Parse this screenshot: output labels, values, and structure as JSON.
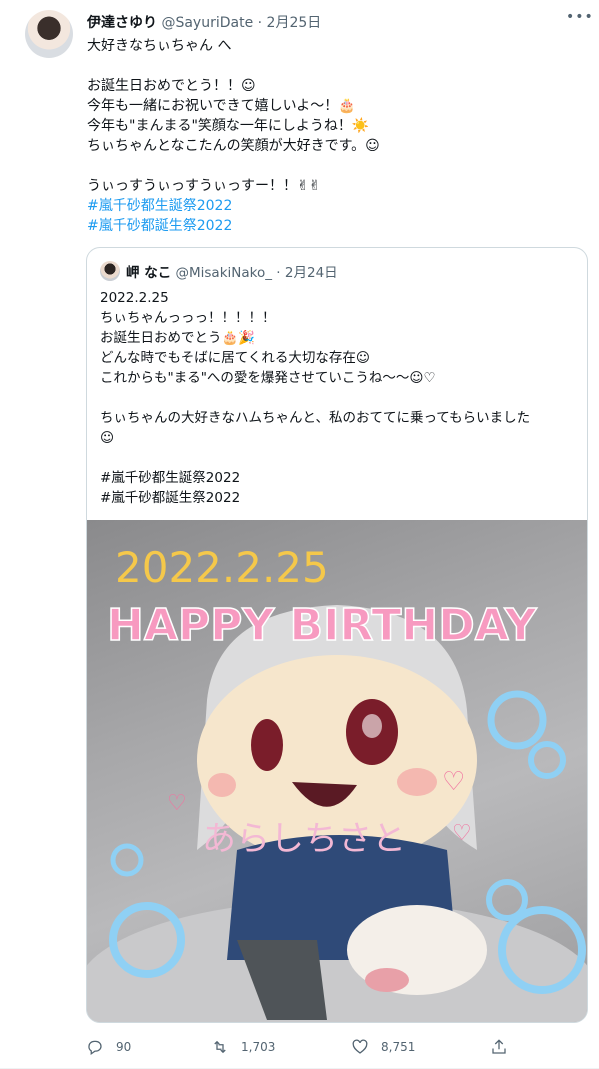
{
  "tweet": {
    "display_name": "伊達さゆり",
    "handle": "@SayuriDate",
    "separator": "·",
    "date": "2月25日",
    "more_label": "•••",
    "lines": [
      "大好きなちぃちゃん へ",
      "",
      "お誕生日おめでとう！！☺",
      "今年も一緒にお祝いできて嬉しいよ〜！🎂",
      "今年も\"まんまる\"笑顔な一年にしようね！☀️",
      "ちぃちゃんとなこたんの笑顔が大好きです。☺",
      "",
      "うぃっすうぃっすうぃっすー！！✌✌"
    ],
    "hashtags": [
      "#嵐千砂都生誕祭2022",
      "#嵐千砂都誕生祭2022"
    ]
  },
  "quote": {
    "display_name": "岬 なこ",
    "handle": "@MisakiNako_",
    "separator": "·",
    "date": "2月24日",
    "lines": [
      "2022.2.25",
      "ちぃちゃんっっっ！！！！！",
      "お誕生日おめでとう🎂🎉",
      "どんな時でもそばに居てくれる大切な存在☺",
      "これからも\"まる\"への愛を爆発させていこうね〜〜☺♡",
      "",
      "ちぃちゃんの大好きなハムちゃんと、私のおててに乗ってもらいました",
      "☺",
      ""
    ],
    "hashtags": [
      "#嵐千砂都生誕祭2022",
      "#嵐千砂都誕生祭2022"
    ],
    "image": {
      "date_text": "2022.2.25",
      "birthday_text": "HAPPY BIRTHDAY",
      "name_text": "あらしちさと"
    }
  },
  "actions": {
    "replies": "90",
    "retweets": "1,703",
    "likes": "8,751"
  },
  "colors": {
    "accent": "#1d9bf0",
    "secondary_text": "#536471",
    "border": "#cfd9de"
  },
  "icons": [
    "reply-icon",
    "retweet-icon",
    "like-icon",
    "share-icon",
    "more-icon"
  ]
}
